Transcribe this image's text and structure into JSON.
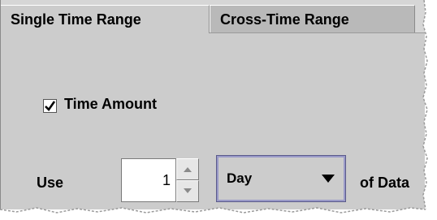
{
  "tabs": [
    {
      "label": "Single Time Range",
      "selected": true
    },
    {
      "label": "Cross-Time Range",
      "selected": false
    }
  ],
  "time_amount": {
    "label": "Time Amount",
    "checked": true
  },
  "use_row": {
    "use_label": "Use",
    "amount_value": "1",
    "unit_selected": "Day",
    "suffix_label": "of Data"
  },
  "icons": {
    "checkbox": "checkmark-icon",
    "spin_up": "spin-up-arrow-icon",
    "spin_down": "spin-down-arrow-icon",
    "combo": "dropdown-arrow-icon"
  },
  "colors": {
    "panel_bg": "#cccccc",
    "inactive_tab_bg": "#b9b9b9",
    "combo_focus_border": "#9a9ac8"
  }
}
